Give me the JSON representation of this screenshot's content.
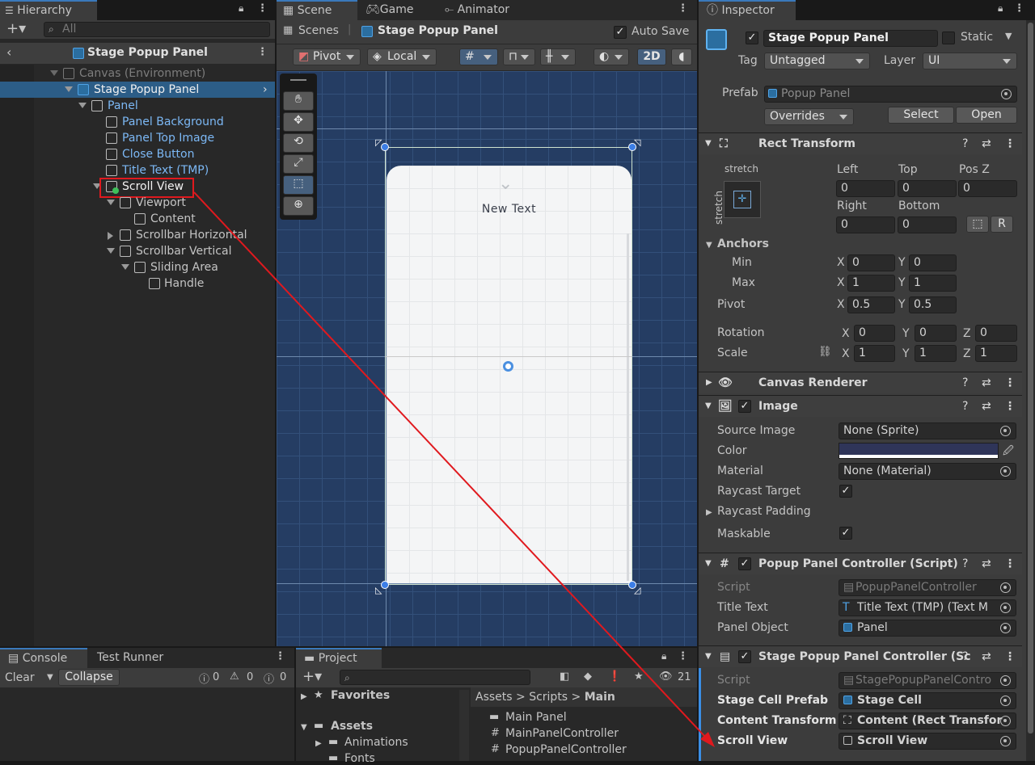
{
  "hierarchy": {
    "tab": "Hierarchy",
    "search_placeholder": "All",
    "scene_title": "Stage Popup Panel",
    "items": [
      {
        "label": "Canvas (Environment)",
        "style": "dim"
      },
      {
        "label": "Stage Popup Panel",
        "style": "sel"
      },
      {
        "label": "Panel",
        "style": "blue"
      },
      {
        "label": "Panel Background",
        "style": "blue"
      },
      {
        "label": "Panel Top Image",
        "style": "blue"
      },
      {
        "label": "Close Button",
        "style": "blue"
      },
      {
        "label": "Title Text (TMP)",
        "style": "blue"
      },
      {
        "label": "Scroll View",
        "style": "white"
      },
      {
        "label": "Viewport",
        "style": "normal"
      },
      {
        "label": "Content",
        "style": "normal"
      },
      {
        "label": "Scrollbar Horizontal",
        "style": "normal"
      },
      {
        "label": "Scrollbar Vertical",
        "style": "normal"
      },
      {
        "label": "Sliding Area",
        "style": "normal"
      },
      {
        "label": "Handle",
        "style": "normal"
      }
    ]
  },
  "scene": {
    "tabs": [
      "Scene",
      "Game",
      "Animator"
    ],
    "breadcrumb_root": "Scenes",
    "breadcrumb_current": "Stage Popup Panel",
    "auto_save": "Auto Save",
    "pivot": "Pivot",
    "local": "Local",
    "mode_2d": "2D",
    "canvas_text": "New Text"
  },
  "inspector": {
    "tab": "Inspector",
    "object_name": "Stage Popup Panel",
    "static_label": "Static",
    "tag_label": "Tag",
    "tag_value": "Untagged",
    "layer_label": "Layer",
    "layer_value": "UI",
    "prefab_label": "Prefab",
    "prefab_value": "Popup Panel",
    "overrides": "Overrides",
    "select": "Select",
    "open": "Open",
    "rect": {
      "title": "Rect Transform",
      "stretch_h": "stretch",
      "stretch_v": "stretch",
      "left_lbl": "Left",
      "top_lbl": "Top",
      "posz_lbl": "Pos Z",
      "left": "0",
      "top": "0",
      "posz": "0",
      "right_lbl": "Right",
      "bottom_lbl": "Bottom",
      "right": "0",
      "bottom": "0",
      "r_btn": "R",
      "anchors": "Anchors",
      "min": "Min",
      "max": "Max",
      "pivot": "Pivot",
      "min_x": "0",
      "min_y": "0",
      "max_x": "1",
      "max_y": "1",
      "pivot_x": "0.5",
      "pivot_y": "0.5",
      "rotation": "Rotation",
      "scale": "Scale",
      "rot_x": "0",
      "rot_y": "0",
      "rot_z": "0",
      "scale_x": "1",
      "scale_y": "1",
      "scale_z": "1"
    },
    "canvas_renderer": "Canvas Renderer",
    "image": {
      "title": "Image",
      "source_lbl": "Source Image",
      "source": "None (Sprite)",
      "color_lbl": "Color",
      "color": "#2f3559",
      "material_lbl": "Material",
      "material": "None (Material)",
      "raycast_target": "Raycast Target",
      "raycast_padding": "Raycast Padding",
      "maskable": "Maskable"
    },
    "popup_ctrl": {
      "title": "Popup Panel Controller (Script)",
      "script_lbl": "Script",
      "script": "PopupPanelController",
      "title_lbl": "Title Text",
      "title_val": "Title Text (TMP) (Text M",
      "panel_lbl": "Panel Object",
      "panel_val": "Panel"
    },
    "stage_ctrl": {
      "title": "Stage Popup Panel Controller (Sc",
      "script_lbl": "Script",
      "script": "StagePopupPanelContro",
      "cell_lbl": "Stage Cell Prefab",
      "cell_val": "Stage Cell",
      "content_lbl": "Content Transform",
      "content_val": "Content (Rect Transfor",
      "scroll_lbl": "Scroll View",
      "scroll_val": "Scroll View"
    }
  },
  "console": {
    "tabs": [
      "Console",
      "Test Runner"
    ],
    "clear": "Clear",
    "collapse": "Collapse",
    "count_info": "0",
    "count_warn": "0",
    "count_err": "0"
  },
  "project": {
    "tab": "Project",
    "favorites": "Favorites",
    "assets": "Assets",
    "animations": "Animations",
    "fonts": "Fonts",
    "breadcrumb": [
      "Assets",
      "Scripts",
      "Main"
    ],
    "files": [
      "Main Panel",
      "MainPanelController",
      "PopupPanelController"
    ],
    "badge": "21"
  },
  "colors": {
    "accent": "#3a79bb",
    "selection": "#2c5d87",
    "annotation": "#e0191e",
    "scene_bg": "#253d63"
  }
}
